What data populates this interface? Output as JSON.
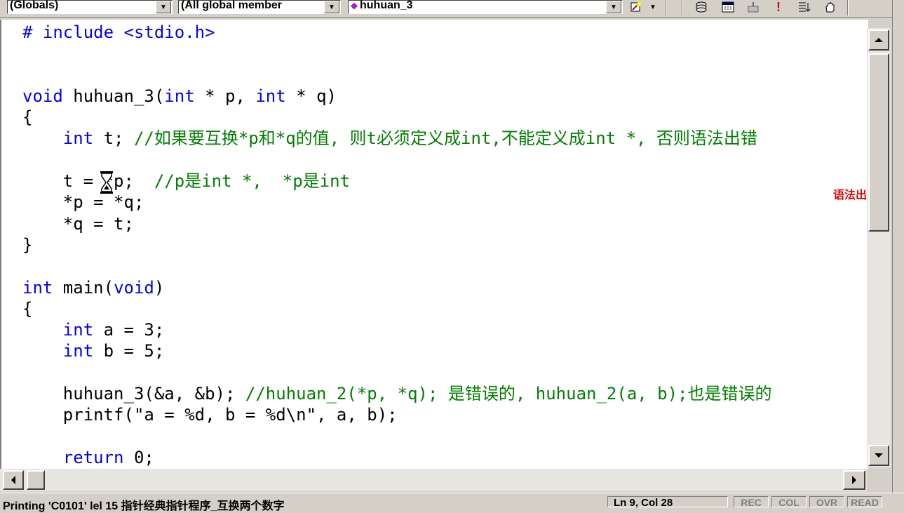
{
  "toolbar": {
    "scope_value": "(Globals)",
    "members_value": "(All global member",
    "function_value": "huhuan_3",
    "icons": [
      "wizard-bar-icon",
      "dropdown-arrow-icon",
      "stack-icon",
      "calendar-icon",
      "build-icon",
      "execute-icon",
      "step-icon",
      "hand-icon"
    ]
  },
  "editor": {
    "lines": [
      [
        {
          "t": "# include <stdio.h>",
          "c": "kw"
        }
      ],
      [],
      [],
      [
        {
          "t": "void",
          "c": "kw"
        },
        {
          "t": " huhuan_3(",
          "c": ""
        },
        {
          "t": "int",
          "c": "kw"
        },
        {
          "t": " * p, ",
          "c": ""
        },
        {
          "t": "int",
          "c": "kw"
        },
        {
          "t": " * q)",
          "c": ""
        }
      ],
      [
        {
          "t": "{",
          "c": ""
        }
      ],
      [
        {
          "t": "    ",
          "c": ""
        },
        {
          "t": "int",
          "c": "kw"
        },
        {
          "t": " t; ",
          "c": ""
        },
        {
          "t": "//如果要互换*p和*q的值, 则t必须定义成int,不能定义成int *, 否则语法出错",
          "c": "cm"
        }
      ],
      [],
      [
        {
          "t": "    t = *p;  ",
          "c": ""
        },
        {
          "t": "//p是int *,  *p是int",
          "c": "cm"
        }
      ],
      [
        {
          "t": "    *p = *q;",
          "c": ""
        }
      ],
      [
        {
          "t": "    *q = t;",
          "c": ""
        }
      ],
      [
        {
          "t": "}",
          "c": ""
        }
      ],
      [],
      [
        {
          "t": "int",
          "c": "kw"
        },
        {
          "t": " main(",
          "c": ""
        },
        {
          "t": "void",
          "c": "kw"
        },
        {
          "t": ")",
          "c": ""
        }
      ],
      [
        {
          "t": "{",
          "c": ""
        }
      ],
      [
        {
          "t": "    ",
          "c": ""
        },
        {
          "t": "int",
          "c": "kw"
        },
        {
          "t": " a = 3;",
          "c": ""
        }
      ],
      [
        {
          "t": "    ",
          "c": ""
        },
        {
          "t": "int",
          "c": "kw"
        },
        {
          "t": " b = 5;",
          "c": ""
        }
      ],
      [],
      [
        {
          "t": "    huhuan_3(&a, &b); ",
          "c": ""
        },
        {
          "t": "//huhuan_2(*p, *q); 是错误的, huhuan_2(a, b);也是错误的",
          "c": "cm"
        }
      ],
      [
        {
          "t": "    printf(\"a = %d, b = %d\\n\", a, b);",
          "c": ""
        }
      ],
      [],
      [
        {
          "t": "    ",
          "c": ""
        },
        {
          "t": "return",
          "c": "kw"
        },
        {
          "t": " 0;",
          "c": ""
        }
      ]
    ],
    "overflow_note": "语法出错"
  },
  "statusbar": {
    "text": "Printing 'C0101' lel 15 指针经典指针程序_互换两个数字",
    "position": "Ln 9, Col 28",
    "indicators": [
      "REC",
      "COL",
      "OVR",
      "READ"
    ]
  },
  "colors": {
    "keyword": "#0000ff",
    "comment": "#008000",
    "note": "#e00000"
  }
}
